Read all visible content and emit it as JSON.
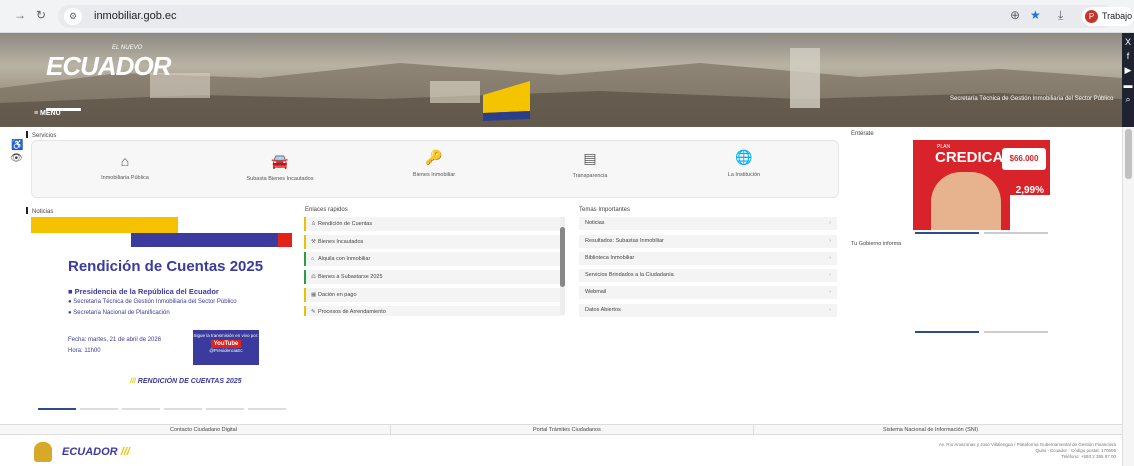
{
  "browser": {
    "url": "inmobiliar.gob.ec",
    "profile_label": "Trabajo",
    "profile_initial": "P"
  },
  "banner": {
    "logo_text": "ECUADOR",
    "logo_small": "EL NUEVO",
    "menu_label": "≡ MENÚ",
    "subtitle": "Secretaría Técnica de Gestión Inmobiliaria del Sector Público",
    "social": [
      "X",
      "f",
      "▶",
      "▬",
      "⌕"
    ]
  },
  "sections": {
    "services": "Servicios",
    "promo": "Entérate",
    "news": "Noticias",
    "quick_links": "Enlaces rapidos",
    "topics": "Temas Importantes",
    "gov_info": "Tu Gobierno informa"
  },
  "services": [
    {
      "icon": "home-icon",
      "label": "Inmobiliaria Pública"
    },
    {
      "icon": "car-icon",
      "label": "Subasta Bienes Incautados"
    },
    {
      "icon": "key-icon",
      "label": "Bienes Inmobiliar"
    },
    {
      "icon": "document-icon",
      "label": "Transparencia"
    },
    {
      "icon": "globe-icon",
      "label": "La Institución"
    }
  ],
  "promo": {
    "brand": "CREDICASA",
    "plan": "PLAN",
    "amount": "$66.000",
    "rate": "2,99%"
  },
  "news": {
    "title": "Rendición de Cuentas 2025",
    "subtitle": "Presidencia de la República del Ecuador",
    "bullets": [
      "Secretaría Técnica de Gestión Inmobiliaria del Sector Público",
      "Secretaría Nacional de Planificación"
    ],
    "date": "Fecha: martes, 21 de abril de 2026",
    "time": "Hora: 11h00",
    "stream_text": "Sigue la transmisión en vivo por:",
    "stream_button": "YouTube",
    "stream_handle": "@PresidenciaEc",
    "footer_logo": "RENDICIÓN DE CUENTAS 2025"
  },
  "quick_links": [
    "Rendición de Cuentas",
    "Bienes Incautados",
    "Alquila con Inmobiliar",
    "Bienes a Subastarse 2025",
    "Dación en pago",
    "Procesos de Arrendamiento"
  ],
  "topics": [
    "Noticias",
    "Resultados: Subastas Inmobiliar",
    "Biblioteca Inmobiliar",
    "Servicios Brindados a la Ciudadanía",
    "Webmail",
    "Datos Abiertos"
  ],
  "footer": {
    "links": [
      "Contacto Ciudadano Digital",
      "Portal Trámites Ciudadanos",
      "Sistema Nacional de Información (SNI)"
    ],
    "logo_text": "ECUADOR",
    "address_lines": [
      "Av. Río Amazonas y José Villalengua / Plataforma Gubernamental de Gestión Financiera",
      "Quito - Ecuador · Código postal: 170506",
      "Teléfono: +593 2 395 87 00"
    ]
  }
}
